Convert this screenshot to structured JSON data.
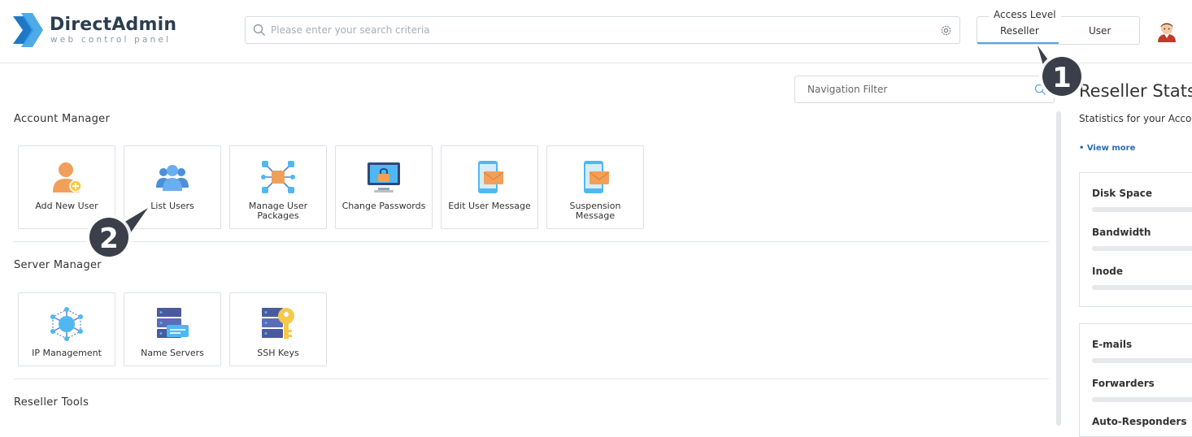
{
  "brand": {
    "name": "DirectAdmin",
    "tagline": "web control panel"
  },
  "search": {
    "placeholder": "Please enter your search criteria",
    "value": ""
  },
  "access_level": {
    "legend": "Access Level",
    "tabs": [
      "Reseller",
      "User"
    ],
    "active": "Reseller"
  },
  "navigation_filter": {
    "placeholder": "Navigation Filter"
  },
  "sections": {
    "account_manager": {
      "title": "Account Manager",
      "items": [
        {
          "label": "Add New User",
          "icon": "add-user-icon"
        },
        {
          "label": "List Users",
          "icon": "users-icon"
        },
        {
          "label": "Manage User Packages",
          "icon": "packages-icon"
        },
        {
          "label": "Change Passwords",
          "icon": "lock-monitor-icon"
        },
        {
          "label": "Edit User Message",
          "icon": "phone-mail-icon"
        },
        {
          "label": "Suspension Message",
          "icon": "phone-mail-icon"
        }
      ]
    },
    "server_manager": {
      "title": "Server Manager",
      "items": [
        {
          "label": "IP Management",
          "icon": "network-icon"
        },
        {
          "label": "Name Servers",
          "icon": "server-icon"
        },
        {
          "label": "SSH Keys",
          "icon": "server-key-icon"
        }
      ]
    },
    "reseller_tools": {
      "title": "Reseller Tools"
    }
  },
  "stats": {
    "title": "Reseller Stats",
    "description": "Statistics for your Accou",
    "view_more": "• View more",
    "group1": [
      "Disk Space",
      "Bandwidth",
      "Inode"
    ],
    "group2": [
      "E-mails",
      "Forwarders",
      "Auto-Responders"
    ]
  },
  "callouts": [
    "1",
    "2"
  ],
  "colors": {
    "accent": "#5aa3d8",
    "brand_blue": "#2f8fd8",
    "link": "#2b6cb0"
  }
}
